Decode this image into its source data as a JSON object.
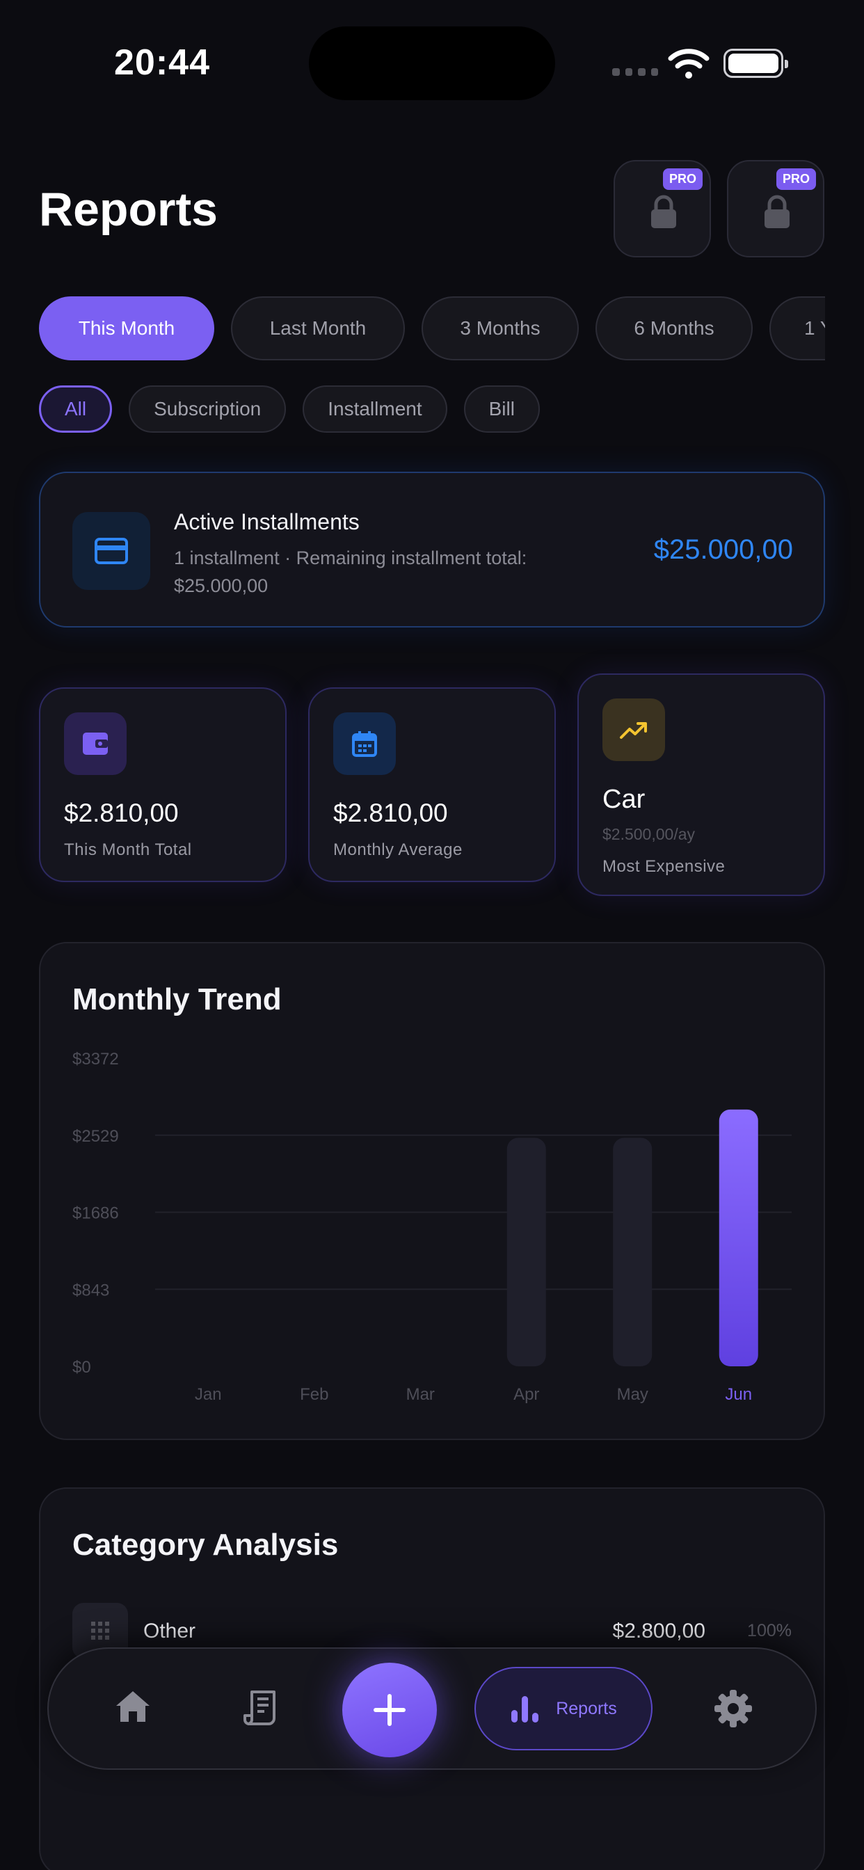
{
  "status": {
    "time": "20:44"
  },
  "header": {
    "title": "Reports",
    "pro_badge": "PRO"
  },
  "periods": [
    "This Month",
    "Last Month",
    "3 Months",
    "6 Months",
    "1 Y"
  ],
  "types": [
    "All",
    "Subscription",
    "Installment",
    "Bill"
  ],
  "installments": {
    "title": "Active Installments",
    "subtitle": "1 installment · Remaining installment total: $25.000,00",
    "amount": "$25.000,00"
  },
  "stats": {
    "total": {
      "value": "$2.810,00",
      "label": "This Month Total"
    },
    "average": {
      "value": "$2.810,00",
      "label": "Monthly Average"
    },
    "expensive": {
      "name": "Car",
      "sub": "$2.500,00/ay",
      "label": "Most Expensive"
    }
  },
  "trend": {
    "title": "Monthly Trend"
  },
  "chart_data": {
    "type": "bar",
    "categories": [
      "Jan",
      "Feb",
      "Mar",
      "Apr",
      "May",
      "Jun"
    ],
    "values": [
      0,
      0,
      0,
      2500,
      2500,
      2810
    ],
    "highlight": "Jun",
    "y_ticks": [
      "$3372",
      "$2529",
      "$1686",
      "$843",
      "$0"
    ],
    "ylim": [
      0,
      3372
    ],
    "grid": true,
    "colors": {
      "bar": "#1f1f2b",
      "highlight_top": "#8b6cff",
      "highlight_bottom": "#5f40e0",
      "highlight_label": "#7b60f2"
    }
  },
  "categories": {
    "title": "Category Analysis",
    "rows": [
      {
        "name": "Other",
        "amount": "$2.800,00",
        "percent": "100%"
      }
    ]
  },
  "tabbar": {
    "reports_label": "Reports"
  },
  "colors": {
    "accent": "#7b60f2",
    "blue": "#2f86f5",
    "background": "#0c0c11"
  }
}
